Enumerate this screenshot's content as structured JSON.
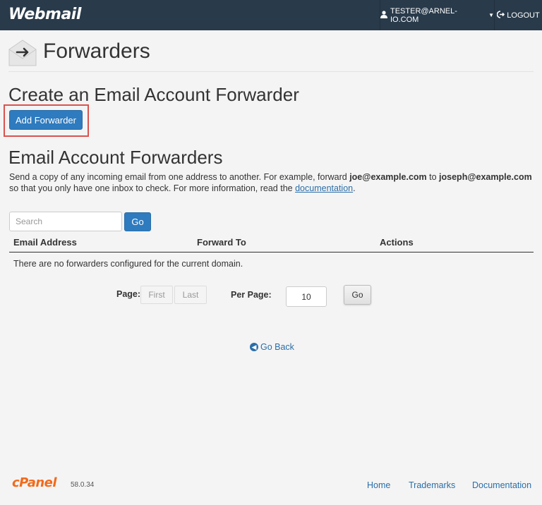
{
  "topbar": {
    "brand": "Webmail",
    "user": "TESTER@ARNEL-IO.COM",
    "logout": "LOGOUT"
  },
  "header": {
    "title": "Forwarders"
  },
  "create_section": {
    "title": "Create an Email Account Forwarder",
    "add_button": "Add Forwarder"
  },
  "list_section": {
    "title": "Email Account Forwarders",
    "desc_part1": "Send a copy of any incoming email from one address to another. For example, forward ",
    "desc_bold1": "joe@example.com",
    "desc_part2": " to ",
    "desc_bold2": "joseph@example.com",
    "desc_part3": " so that you only have one inbox to check. For more information, read the ",
    "desc_link": "documentation",
    "desc_end": "."
  },
  "search": {
    "placeholder": "Search",
    "go_label": "Go"
  },
  "table": {
    "columns": [
      "Email Address",
      "Forward To",
      "Actions"
    ],
    "empty_message": "There are no forwarders configured for the current domain."
  },
  "pagination": {
    "page_label": "Page:",
    "first": "First",
    "last": "Last",
    "per_page_label": "Per Page:",
    "per_page_value": "10",
    "go_label": "Go"
  },
  "go_back": "Go Back",
  "footer": {
    "logo": "cPanel",
    "version": "58.0.34",
    "links": [
      "Home",
      "Trademarks",
      "Documentation"
    ]
  },
  "colors": {
    "topbar": "#293a4a",
    "primary": "#2e7bbf",
    "link": "#2a6ea8",
    "highlight": "#d9534f",
    "cpanel_orange": "#f26a1b"
  }
}
